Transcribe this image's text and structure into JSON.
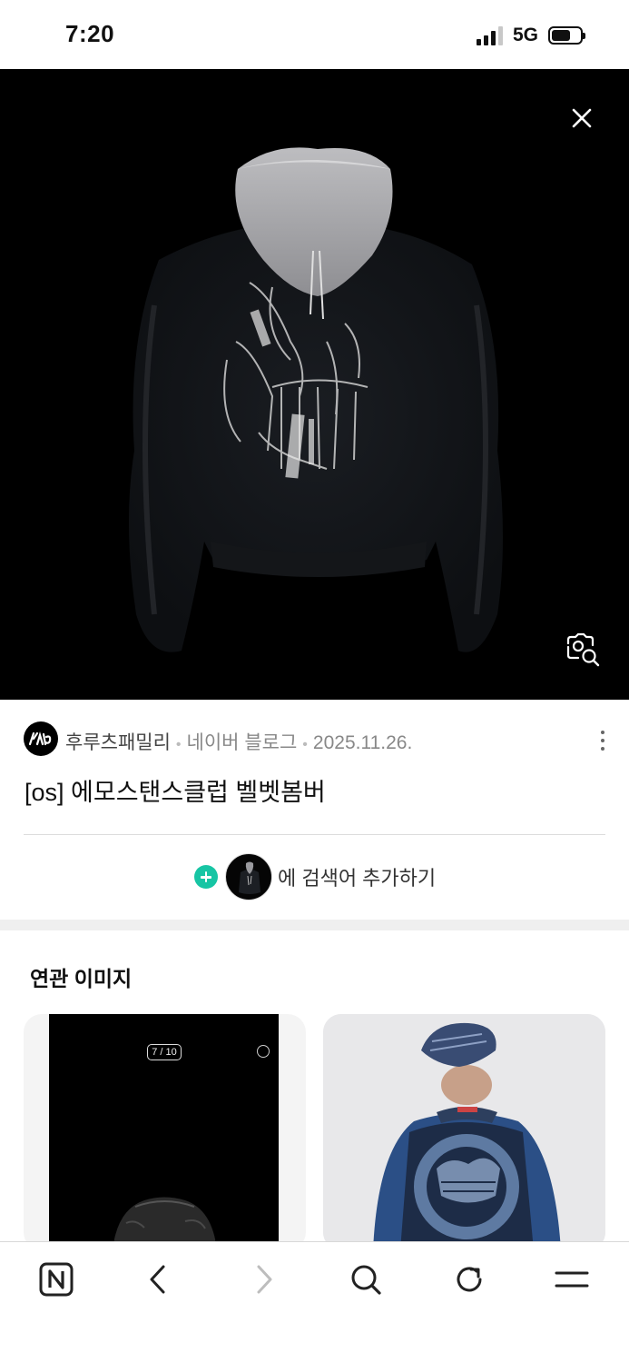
{
  "status_bar": {
    "time": "7:20",
    "network": "5G"
  },
  "viewer": {
    "close_icon": "close-icon",
    "lens_icon": "image-search-icon",
    "background": "#000000"
  },
  "result": {
    "source_name": "후루츠패밀리",
    "platform": "네이버 블로그",
    "date": "2025.11.26.",
    "title": "[os] 에모스탠스클럽 벨벳봄버",
    "add_search_label": "에 검색어 추가하기",
    "accent_color": "#17c5a4"
  },
  "related": {
    "title": "연관 이미지",
    "cards": [
      {
        "counter": "7 / 10"
      },
      {}
    ]
  },
  "toolbar": {
    "icons": [
      "naver-home-icon",
      "back-icon",
      "forward-icon",
      "search-icon",
      "refresh-icon",
      "menu-icon"
    ]
  }
}
